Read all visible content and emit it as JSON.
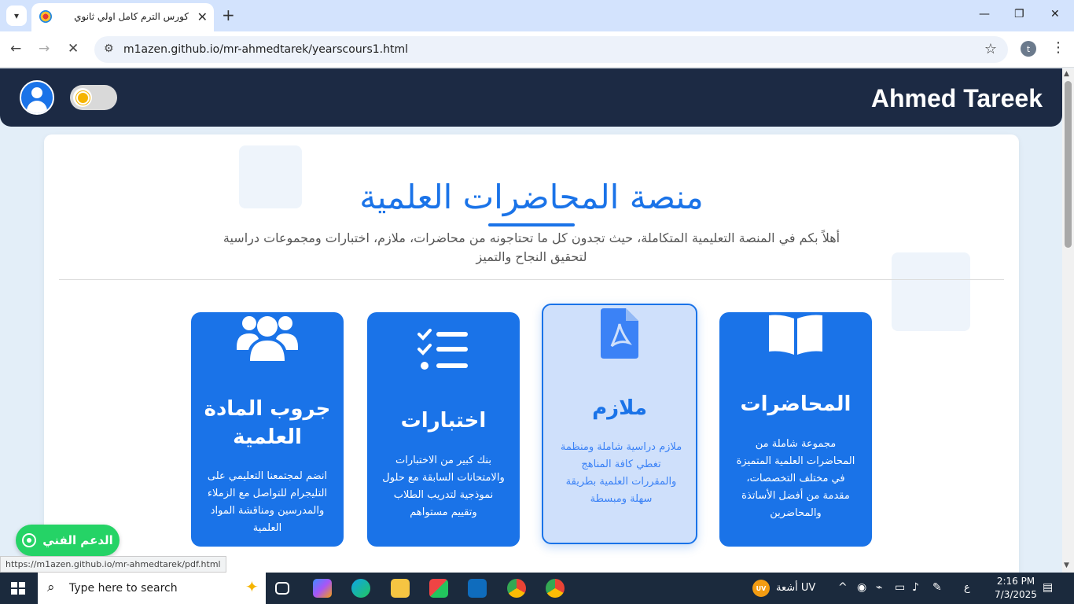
{
  "browser": {
    "tab_title": "كورس الترم كامل اولي ثانوي",
    "url": "m1azen.github.io/mr-ahmedtarek/yearscours1.html",
    "profile_initial": "t",
    "status_link": "https://m1azen.github.io/mr-ahmedtarek/pdf.html"
  },
  "header": {
    "brand": "Ahmed Tareek"
  },
  "hero": {
    "title": "منصة المحاضرات العلمية",
    "subtitle": "أهلاً بكم في المنصة التعليمية المتكاملة، حيث تجدون كل ما تحتاجونه من محاضرات، ملازم، اختبارات ومجموعات دراسية لتحقيق النجاح والتميز"
  },
  "cards": [
    {
      "title": "جروب المادة العلمية",
      "desc": "انضم لمجتمعنا التعليمي على التليجرام للتواصل مع الزملاء والمدرسين ومناقشة المواد العلمية",
      "icon": "users-icon"
    },
    {
      "title": "اختبارات",
      "desc": "بنك كبير من الاختبارات والامتحانات السابقة مع حلول نموذجية لتدريب الطلاب وتقييم مستواهم",
      "icon": "checklist-icon"
    },
    {
      "title": "ملازم",
      "desc": "ملازم دراسية شاملة ومنظمة تغطي كافة المناهج والمقررات العلمية بطريقة سهلة ومبسطة",
      "icon": "pdf-file-icon"
    },
    {
      "title": "المحاضرات",
      "desc": "مجموعة شاملة من المحاضرات العلمية المتميزة في مختلف التخصصات، مقدمة من أفضل الأساتذة والمحاضرين",
      "icon": "book-icon"
    }
  ],
  "support": {
    "label": "الدعم الفني",
    "icon": "whatsapp-icon"
  },
  "taskbar": {
    "search_placeholder": "Type here to search",
    "weather": "أشعة UV",
    "uv_badge": "UV",
    "ime": "ع",
    "time": "2:16 PM",
    "date": "7/3/2025"
  },
  "colors": {
    "primary": "#1a73e8",
    "header_bg": "#1c2a44",
    "support_green": "#25d366"
  }
}
